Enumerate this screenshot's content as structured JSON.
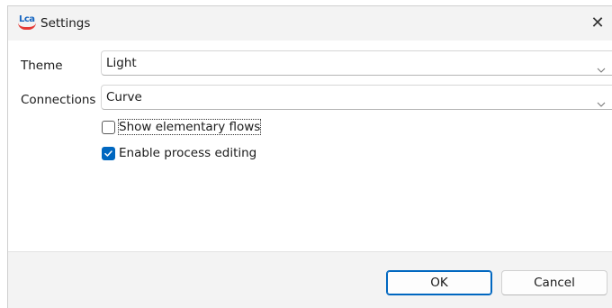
{
  "window": {
    "title": "Settings",
    "app_icon_text": "Lca",
    "close_symbol": "✕"
  },
  "form": {
    "theme": {
      "label": "Theme",
      "value": "Light"
    },
    "connections": {
      "label": "Connections",
      "value": "Curve"
    },
    "show_elementary_flows": {
      "label": "Show elementary flows",
      "checked": false
    },
    "enable_process_editing": {
      "label": "Enable process editing",
      "checked": true
    }
  },
  "buttons": {
    "ok_label": "OK",
    "cancel_label": "Cancel"
  },
  "colors": {
    "accent": "#0067c0",
    "titlebar_bg": "#f3f3f3",
    "footer_bg": "#f3f3f3"
  },
  "icons": {
    "dropdown": "chevron-down-icon",
    "close": "close-icon",
    "check": "checkmark-icon"
  }
}
